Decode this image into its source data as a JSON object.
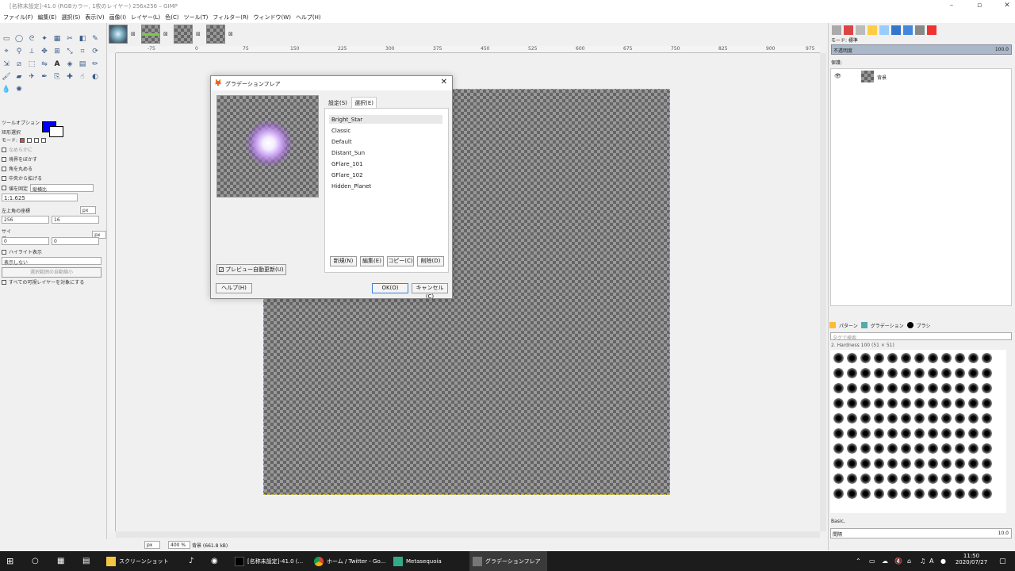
{
  "window": {
    "title": "[名称未設定]-41.0 (RGBカラー, 1枚のレイヤー) 256x256 – GIMP",
    "minimize": "–",
    "maximize": "▫",
    "close": "✕"
  },
  "menu": [
    "ファイル(F)",
    "編集(E)",
    "選択(S)",
    "表示(V)",
    "画像(I)",
    "レイヤー(L)",
    "色(C)",
    "ツール(T)",
    "フィルター(R)",
    "ウィンドウ(W)",
    "ヘルプ(H)"
  ],
  "toolbox": {
    "colors": {
      "fg": "#0000ff",
      "bg": "#ffffff"
    },
    "options_title": "ツールオプション",
    "tool_name": "矩形選択",
    "mode_label": "モード:",
    "antialias": "なめらかに",
    "feather": "境界をぼかす",
    "rounded": "角を丸める",
    "expand_center": "中央から拡げる",
    "fixed": "値を固定",
    "fixed_value": "縦横比",
    "ratio": "1:1.625",
    "position_label": "左上角の座標",
    "unit": "px",
    "pos_x": "256",
    "pos_y": "16",
    "size_label": "サイズ",
    "size_w": "0",
    "size_h": "0",
    "highlight": "ハイライト表示",
    "guides": "表示しない",
    "auto_shrink": "選択範囲の自動縮小",
    "shrink_merged": "すべての可視レイヤーを対象にする"
  },
  "ruler": {
    "h_marks": [
      "-75",
      "0",
      "75",
      "150",
      "225",
      "300",
      "375",
      "450",
      "525",
      "600",
      "675",
      "750",
      "825",
      "900",
      "975"
    ]
  },
  "status": {
    "unit": "px",
    "zoom": "400 %",
    "info": "背景 (661.8 kB)"
  },
  "layers": {
    "mode_label": "モード: 標準",
    "opacity_label": "不透明度",
    "opacity_value": "100.0",
    "lock_label": "保護:",
    "layer_name": "背景"
  },
  "brushes": {
    "tabs": [
      "パターン",
      "グラデーション",
      "ブラシ"
    ],
    "tag_placeholder": "タグで検索",
    "current": "2. Hardness 100 (51 × 51)",
    "preset": "Basic,",
    "spacing_label": "間隔",
    "spacing_value": "10.0"
  },
  "dialog": {
    "title": "グラデーションフレア",
    "tabs": [
      "設定(S)",
      "選択(E)"
    ],
    "items": [
      "Bright_Star",
      "Classic",
      "Default",
      "Distant_Sun",
      "GFlare_101",
      "GFlare_102",
      "Hidden_Planet"
    ],
    "selected": "Bright_Star",
    "new": "新規(N)",
    "edit": "編集(E)",
    "copy": "コピー(C)",
    "delete": "削除(D)",
    "preview_auto": "プレビュー自動更新(U)",
    "help": "ヘルプ(H)",
    "ok": "OK(O)",
    "cancel": "キャンセル(C)"
  },
  "taskbar": {
    "items": [
      "スクリーンショット",
      "[名称未設定]-41.0 (...",
      "ホーム / Twitter - Go...",
      "Metasequoia",
      "グラデーションフレア"
    ],
    "time": "11:50",
    "date": "2020/07/27",
    "ime": "A"
  }
}
